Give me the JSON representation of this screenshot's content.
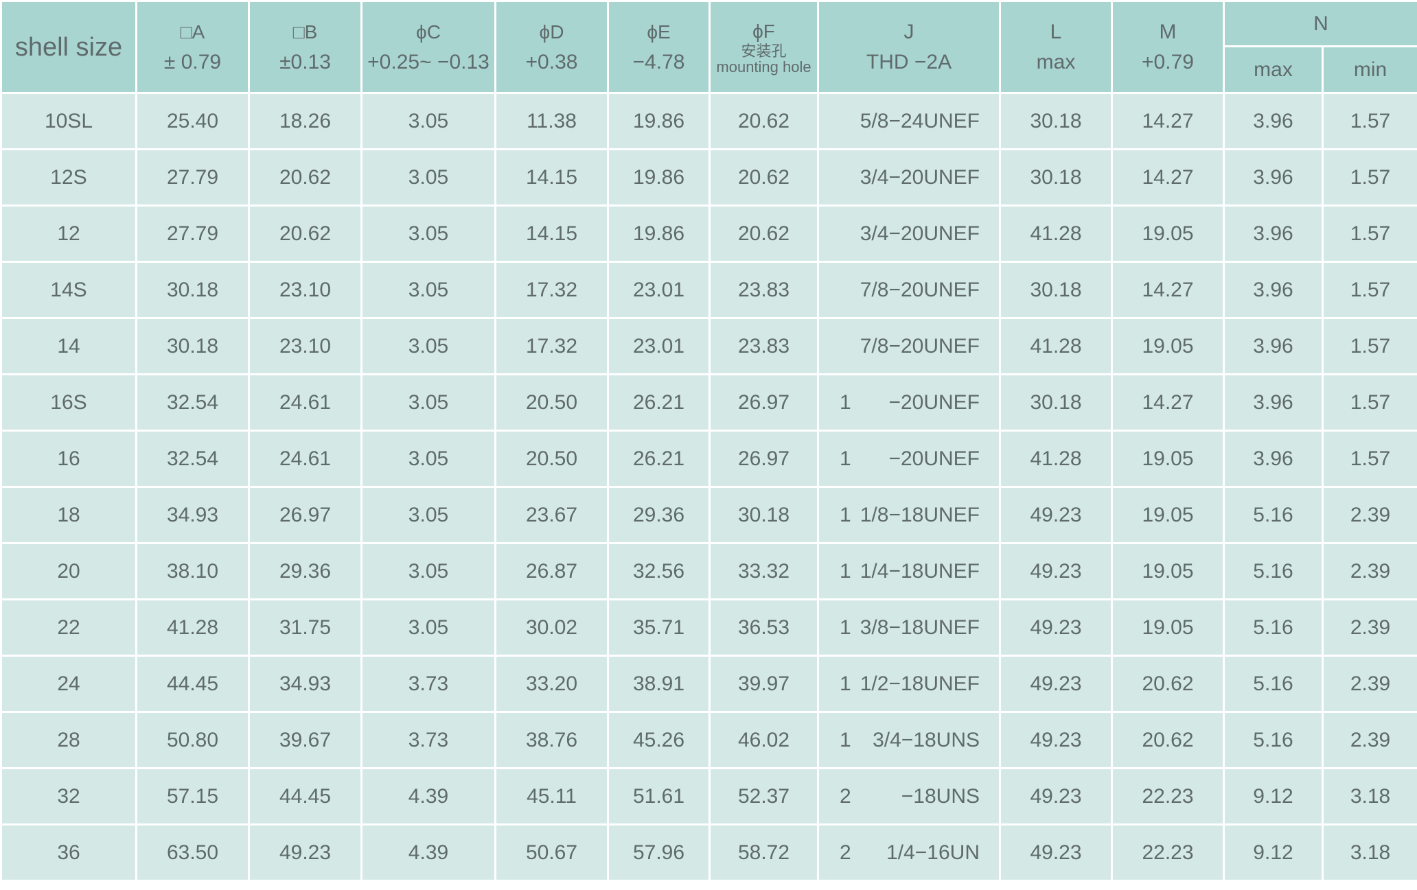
{
  "header": {
    "shell": "shell size",
    "A": {
      "l1": "□A",
      "l2": "± 0.79"
    },
    "B": {
      "l1": "□B",
      "l2": "±0.13"
    },
    "C": {
      "l1": "ϕC",
      "l2": "+0.25~ −0.13"
    },
    "D": {
      "l1": "ϕD",
      "l2": "+0.38"
    },
    "E": {
      "l1": "ϕE",
      "l2": "−4.78"
    },
    "F": {
      "l1": "ϕF",
      "l2": "安装孔",
      "l3": "mounting hole"
    },
    "J": {
      "l1": "J",
      "l2": "THD −2A"
    },
    "L": {
      "l1": "L",
      "l2": "max"
    },
    "M": {
      "l1": "M",
      "l2": "+0.79"
    },
    "N": {
      "l1": "N",
      "max": "max",
      "min": "min"
    }
  },
  "rows": [
    {
      "shell": "10SL",
      "A": "25.40",
      "B": "18.26",
      "C": "3.05",
      "D": "11.38",
      "E": "19.86",
      "F": "20.62",
      "Jpre": "",
      "J": "5/8−24UNEF",
      "L": "30.18",
      "M": "14.27",
      "Nmax": "3.96",
      "Nmin": "1.57"
    },
    {
      "shell": "12S",
      "A": "27.79",
      "B": "20.62",
      "C": "3.05",
      "D": "14.15",
      "E": "19.86",
      "F": "20.62",
      "Jpre": "",
      "J": "3/4−20UNEF",
      "L": "30.18",
      "M": "14.27",
      "Nmax": "3.96",
      "Nmin": "1.57"
    },
    {
      "shell": "12",
      "A": "27.79",
      "B": "20.62",
      "C": "3.05",
      "D": "14.15",
      "E": "19.86",
      "F": "20.62",
      "Jpre": "",
      "J": "3/4−20UNEF",
      "L": "41.28",
      "M": "19.05",
      "Nmax": "3.96",
      "Nmin": "1.57"
    },
    {
      "shell": "14S",
      "A": "30.18",
      "B": "23.10",
      "C": "3.05",
      "D": "17.32",
      "E": "23.01",
      "F": "23.83",
      "Jpre": "",
      "J": "7/8−20UNEF",
      "L": "30.18",
      "M": "14.27",
      "Nmax": "3.96",
      "Nmin": "1.57"
    },
    {
      "shell": "14",
      "A": "30.18",
      "B": "23.10",
      "C": "3.05",
      "D": "17.32",
      "E": "23.01",
      "F": "23.83",
      "Jpre": "",
      "J": "7/8−20UNEF",
      "L": "41.28",
      "M": "19.05",
      "Nmax": "3.96",
      "Nmin": "1.57"
    },
    {
      "shell": "16S",
      "A": "32.54",
      "B": "24.61",
      "C": "3.05",
      "D": "20.50",
      "E": "26.21",
      "F": "26.97",
      "Jpre": "1",
      "J": "−20UNEF",
      "L": "30.18",
      "M": "14.27",
      "Nmax": "3.96",
      "Nmin": "1.57"
    },
    {
      "shell": "16",
      "A": "32.54",
      "B": "24.61",
      "C": "3.05",
      "D": "20.50",
      "E": "26.21",
      "F": "26.97",
      "Jpre": "1",
      "J": "−20UNEF",
      "L": "41.28",
      "M": "19.05",
      "Nmax": "3.96",
      "Nmin": "1.57"
    },
    {
      "shell": "18",
      "A": "34.93",
      "B": "26.97",
      "C": "3.05",
      "D": "23.67",
      "E": "29.36",
      "F": "30.18",
      "Jpre": "1",
      "J": "1/8−18UNEF",
      "L": "49.23",
      "M": "19.05",
      "Nmax": "5.16",
      "Nmin": "2.39"
    },
    {
      "shell": "20",
      "A": "38.10",
      "B": "29.36",
      "C": "3.05",
      "D": "26.87",
      "E": "32.56",
      "F": "33.32",
      "Jpre": "1",
      "J": "1/4−18UNEF",
      "L": "49.23",
      "M": "19.05",
      "Nmax": "5.16",
      "Nmin": "2.39"
    },
    {
      "shell": "22",
      "A": "41.28",
      "B": "31.75",
      "C": "3.05",
      "D": "30.02",
      "E": "35.71",
      "F": "36.53",
      "Jpre": "1",
      "J": "3/8−18UNEF",
      "L": "49.23",
      "M": "19.05",
      "Nmax": "5.16",
      "Nmin": "2.39"
    },
    {
      "shell": "24",
      "A": "44.45",
      "B": "34.93",
      "C": "3.73",
      "D": "33.20",
      "E": "38.91",
      "F": "39.97",
      "Jpre": "1",
      "J": "1/2−18UNEF",
      "L": "49.23",
      "M": "20.62",
      "Nmax": "5.16",
      "Nmin": "2.39"
    },
    {
      "shell": "28",
      "A": "50.80",
      "B": "39.67",
      "C": "3.73",
      "D": "38.76",
      "E": "45.26",
      "F": "46.02",
      "Jpre": "1",
      "J": "3/4−18UNS",
      "L": "49.23",
      "M": "20.62",
      "Nmax": "5.16",
      "Nmin": "2.39"
    },
    {
      "shell": "32",
      "A": "57.15",
      "B": "44.45",
      "C": "4.39",
      "D": "45.11",
      "E": "51.61",
      "F": "52.37",
      "Jpre": "2",
      "J": "−18UNS",
      "L": "49.23",
      "M": "22.23",
      "Nmax": "9.12",
      "Nmin": "3.18"
    },
    {
      "shell": "36",
      "A": "63.50",
      "B": "49.23",
      "C": "4.39",
      "D": "50.67",
      "E": "57.96",
      "F": "58.72",
      "Jpre": "2",
      "J": "1/4−16UN",
      "L": "49.23",
      "M": "22.23",
      "Nmax": "9.12",
      "Nmin": "3.18"
    }
  ]
}
